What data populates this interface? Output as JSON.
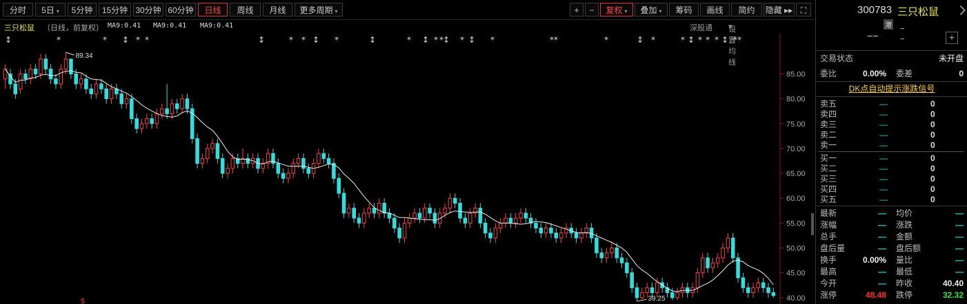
{
  "toolbar": {
    "left": [
      {
        "label": "分时"
      },
      {
        "label": "5日",
        "dropdown": true
      },
      {
        "label": "5分钟"
      },
      {
        "label": "15分钟"
      },
      {
        "label": "30分钟"
      },
      {
        "label": "60分钟"
      },
      {
        "label": "日线",
        "active": true
      },
      {
        "label": "周线"
      },
      {
        "label": "月线"
      },
      {
        "label": "更多周期",
        "dropdown": true
      }
    ],
    "right": [
      {
        "label": "+"
      },
      {
        "label": "−"
      },
      {
        "label": "复权",
        "active": true,
        "dropdown": true
      },
      {
        "label": "叠加",
        "dropdown": true
      },
      {
        "label": "筹码"
      },
      {
        "label": "画线"
      },
      {
        "label": "简约"
      },
      {
        "label": "隐藏 ▸▸"
      },
      {
        "label": "⛶"
      }
    ]
  },
  "chart_header": {
    "name": "三只松鼠",
    "period": "（日线，前复权）",
    "ma_labels": [
      "MA9:0.41",
      "MA9:0.41",
      "MA9:0.41"
    ],
    "deep_observe": "深股通",
    "set_ma": "设置均线"
  },
  "chart_data": {
    "type": "candlestick",
    "y_ticks": [
      "85.00",
      "80.00",
      "75.00",
      "70.00",
      "65.00",
      "60.00",
      "55.00",
      "50.00",
      "45.00",
      "40.00"
    ],
    "y_range": [
      39,
      89.5
    ],
    "high_label": "89.34",
    "low_label": "39.25",
    "candles": [
      [
        84,
        86,
        82,
        87
      ],
      [
        85,
        83,
        82,
        86
      ],
      [
        83,
        81,
        80,
        84
      ],
      [
        82,
        85,
        81,
        86
      ],
      [
        85,
        84,
        83,
        86
      ],
      [
        84,
        86,
        83,
        87
      ],
      [
        86,
        85,
        84,
        87
      ],
      [
        85,
        88,
        84,
        89
      ],
      [
        88,
        86,
        85,
        89
      ],
      [
        86,
        84,
        83,
        87
      ],
      [
        84,
        83,
        82,
        85
      ],
      [
        83,
        86,
        82,
        87
      ],
      [
        86,
        88,
        85,
        89.34
      ],
      [
        88,
        85,
        84,
        88
      ],
      [
        85,
        83,
        82,
        86
      ],
      [
        83,
        84,
        82,
        85
      ],
      [
        84,
        82,
        81,
        85
      ],
      [
        82,
        81,
        80,
        83
      ],
      [
        81,
        83,
        80,
        84
      ],
      [
        83,
        82,
        81,
        84
      ],
      [
        82,
        80,
        79,
        83
      ],
      [
        80,
        82,
        79,
        83
      ],
      [
        82,
        81,
        80,
        83
      ],
      [
        81,
        79,
        78,
        82
      ],
      [
        79,
        80,
        78,
        81
      ],
      [
        80,
        76,
        75,
        81
      ],
      [
        76,
        74,
        73,
        77
      ],
      [
        74,
        75,
        73,
        76
      ],
      [
        75,
        76,
        74,
        77
      ],
      [
        76,
        75,
        74,
        77
      ],
      [
        75,
        77,
        74,
        78
      ],
      [
        77,
        78,
        76,
        79
      ],
      [
        78,
        77,
        76,
        83
      ],
      [
        77,
        79,
        76,
        80
      ],
      [
        79,
        78,
        77,
        80
      ],
      [
        78,
        80,
        77,
        81
      ],
      [
        80,
        78,
        77,
        81
      ],
      [
        78,
        72,
        71,
        79
      ],
      [
        72,
        67,
        66,
        73
      ],
      [
        67,
        68,
        66,
        69
      ],
      [
        68,
        70,
        67,
        71
      ],
      [
        70,
        71,
        69,
        72
      ],
      [
        71,
        68,
        67,
        72
      ],
      [
        68,
        65,
        64,
        69
      ],
      [
        65,
        66,
        64,
        67
      ],
      [
        66,
        68,
        65,
        69
      ],
      [
        68,
        67,
        66,
        69
      ],
      [
        67,
        68,
        66,
        70
      ],
      [
        68,
        67,
        66,
        69
      ],
      [
        67,
        68,
        66,
        69
      ],
      [
        68,
        66,
        65,
        69
      ],
      [
        66,
        67,
        65,
        68
      ],
      [
        67,
        69,
        66,
        70
      ],
      [
        69,
        67,
        66,
        70
      ],
      [
        67,
        65,
        64,
        68
      ],
      [
        65,
        64,
        63,
        66
      ],
      [
        64,
        65,
        63,
        66
      ],
      [
        65,
        67,
        64,
        68
      ],
      [
        67,
        68,
        66,
        69
      ],
      [
        68,
        66,
        65,
        69
      ],
      [
        66,
        65,
        64,
        67
      ],
      [
        65,
        67,
        64,
        68
      ],
      [
        67,
        69,
        66,
        70
      ],
      [
        69,
        68,
        67,
        70
      ],
      [
        68,
        67,
        66,
        69
      ],
      [
        67,
        64,
        63,
        68
      ],
      [
        64,
        61,
        60,
        65
      ],
      [
        61,
        57,
        56,
        62
      ],
      [
        57,
        58,
        56,
        59
      ],
      [
        58,
        56,
        55,
        59
      ],
      [
        56,
        55,
        54,
        57
      ],
      [
        55,
        57,
        54,
        58
      ],
      [
        57,
        58,
        56,
        59
      ],
      [
        58,
        57,
        56,
        59
      ],
      [
        57,
        59,
        56,
        60
      ],
      [
        59,
        57,
        56,
        60
      ],
      [
        57,
        56,
        55,
        58
      ],
      [
        56,
        54,
        53,
        57
      ],
      [
        54,
        52,
        51,
        55
      ],
      [
        52,
        55,
        51,
        56
      ],
      [
        55,
        56,
        54,
        57
      ],
      [
        56,
        57,
        55,
        58
      ],
      [
        57,
        56,
        55,
        58
      ],
      [
        56,
        58,
        55,
        59
      ],
      [
        58,
        57,
        56,
        59
      ],
      [
        57,
        55,
        54,
        58
      ],
      [
        55,
        57,
        54,
        58
      ],
      [
        57,
        58,
        56,
        59
      ],
      [
        58,
        60,
        57,
        61
      ],
      [
        60,
        59,
        58,
        61
      ],
      [
        59,
        56,
        55,
        60
      ],
      [
        56,
        55,
        54,
        57
      ],
      [
        55,
        57,
        54,
        58
      ],
      [
        57,
        58,
        56,
        59
      ],
      [
        58,
        55,
        54,
        59
      ],
      [
        55,
        53,
        52,
        56
      ],
      [
        53,
        52,
        51,
        54
      ],
      [
        52,
        54,
        51,
        55
      ],
      [
        54,
        55,
        53,
        56
      ],
      [
        55,
        56,
        54,
        57
      ],
      [
        56,
        55,
        54,
        57
      ],
      [
        55,
        56,
        54,
        57
      ],
      [
        56,
        57,
        55,
        58
      ],
      [
        57,
        56,
        55,
        58
      ],
      [
        56,
        55,
        54,
        57
      ],
      [
        55,
        54,
        53,
        56
      ],
      [
        54,
        53,
        52,
        55
      ],
      [
        53,
        54,
        52,
        55
      ],
      [
        54,
        53,
        52,
        55
      ],
      [
        53,
        52,
        51,
        54
      ],
      [
        52,
        53,
        51,
        54
      ],
      [
        53,
        54,
        52,
        55
      ],
      [
        54,
        53,
        52,
        55
      ],
      [
        53,
        52,
        51,
        54
      ],
      [
        52,
        53,
        51,
        54
      ],
      [
        53,
        54,
        52,
        55
      ],
      [
        54,
        52,
        51,
        55
      ],
      [
        52,
        49,
        48,
        53
      ],
      [
        49,
        48,
        47,
        50
      ],
      [
        48,
        49,
        47,
        50
      ],
      [
        49,
        50,
        48,
        51
      ],
      [
        50,
        48,
        47,
        51
      ],
      [
        48,
        47,
        46,
        49
      ],
      [
        47,
        45,
        44,
        48
      ],
      [
        45,
        42,
        41,
        46
      ],
      [
        42,
        40,
        39.25,
        43
      ],
      [
        40,
        41,
        39.5,
        42
      ],
      [
        41,
        42,
        40,
        43
      ],
      [
        42,
        41,
        40,
        43
      ],
      [
        41,
        43,
        40,
        44
      ],
      [
        43,
        42,
        41,
        44
      ],
      [
        42,
        41,
        40,
        43
      ],
      [
        41,
        40,
        39.5,
        42
      ],
      [
        40,
        41,
        39.5,
        42
      ],
      [
        41,
        42,
        40,
        43
      ],
      [
        42,
        41,
        40,
        43
      ],
      [
        41,
        42,
        40,
        43
      ],
      [
        42,
        45,
        41,
        46
      ],
      [
        45,
        48,
        44,
        49
      ],
      [
        48,
        46,
        45,
        49
      ],
      [
        46,
        47,
        45,
        48
      ],
      [
        47,
        48,
        46,
        49
      ],
      [
        48,
        50,
        47,
        51
      ],
      [
        50,
        52,
        49,
        53
      ],
      [
        52,
        48,
        47,
        53
      ],
      [
        48,
        44,
        43,
        49
      ],
      [
        44,
        42,
        41,
        45
      ],
      [
        42,
        41,
        40,
        43
      ],
      [
        41,
        42,
        40,
        43
      ],
      [
        42,
        43,
        41,
        44
      ],
      [
        43,
        42,
        41,
        44
      ],
      [
        42,
        41,
        40,
        43
      ],
      [
        41,
        40.4,
        40,
        42
      ]
    ]
  },
  "side": {
    "code": "300783",
    "name": "三只松鼠",
    "badge": "港",
    "price": "−−",
    "chg1": "−",
    "chg2": "−",
    "plus": "+",
    "status_label": "交易状态",
    "status_value": "未开盘",
    "weibi_label": "委比",
    "weibi_value": "0.00%",
    "weicha_label": "委差",
    "weicha_value": "0",
    "dk_link": "DK点自动提示涨跌信号",
    "asks": [
      {
        "label": "卖五",
        "price": "—",
        "vol": "0"
      },
      {
        "label": "卖四",
        "price": "—",
        "vol": "0"
      },
      {
        "label": "卖三",
        "price": "—",
        "vol": "0"
      },
      {
        "label": "卖二",
        "price": "—",
        "vol": "0"
      },
      {
        "label": "卖一",
        "price": "—",
        "vol": "0"
      }
    ],
    "bids": [
      {
        "label": "买一",
        "price": "—",
        "vol": "0"
      },
      {
        "label": "买二",
        "price": "—",
        "vol": "0"
      },
      {
        "label": "买三",
        "price": "—",
        "vol": "0"
      },
      {
        "label": "买四",
        "price": "—",
        "vol": "0"
      },
      {
        "label": "买五",
        "price": "—",
        "vol": "0"
      }
    ],
    "quotes": [
      {
        "l1": "最新",
        "v1": "—",
        "l2": "均价",
        "v2": "—"
      },
      {
        "l1": "涨幅",
        "v1": "—",
        "l2": "涨跌",
        "v2": "—"
      },
      {
        "l1": "总手",
        "v1": "—",
        "l2": "金额",
        "v2": "—"
      },
      {
        "l1": "盘后量",
        "v1": "—",
        "l2": "盘后额",
        "v2": "—"
      },
      {
        "l1": "换手",
        "v1": "0.00%",
        "l2": "量比",
        "v2": "—"
      },
      {
        "l1": "最高",
        "v1": "—",
        "l2": "最低",
        "v2": "—"
      },
      {
        "l1": "今开",
        "v1": "—",
        "l2": "昨收",
        "v2": "40.40"
      },
      {
        "l1": "涨停",
        "v1": "48.48",
        "l2": "跌停",
        "v2": "32.32"
      }
    ]
  }
}
